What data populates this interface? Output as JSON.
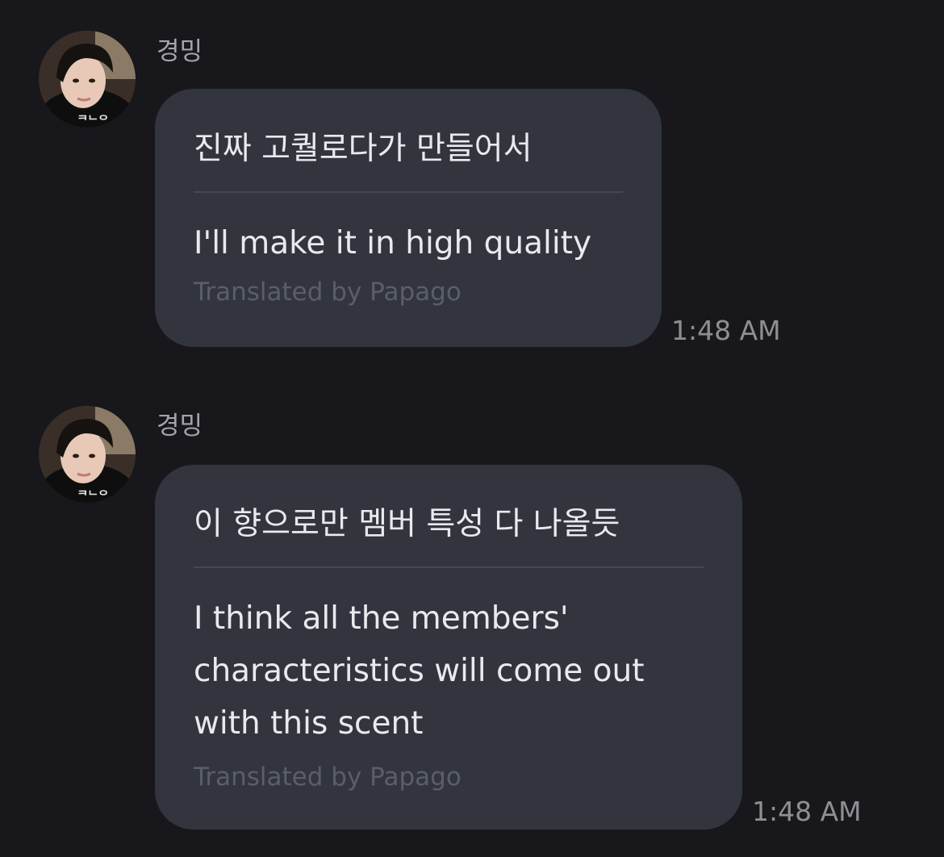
{
  "messages": [
    {
      "sender": "경밍",
      "avatar_icon": "profile-photo",
      "original": "진짜 고퀄로다가 만들어서",
      "translation": "I'll make it in high quality",
      "translator_credit": "Translated by Papago",
      "time": "1:48 AM"
    },
    {
      "sender": "경밍",
      "avatar_icon": "profile-photo",
      "original": "이 향으로만 멤버 특성 다 나올듯",
      "translation": "I think all the members' characteristics will come out with this scent",
      "translator_credit": "Translated by Papago",
      "time": "1:48 AM"
    }
  ],
  "colors": {
    "background": "#17171c",
    "bubble": "#32353d",
    "text": "#e9e9ee",
    "muted": "#5b5e66",
    "timestamp": "#8e8e93"
  }
}
